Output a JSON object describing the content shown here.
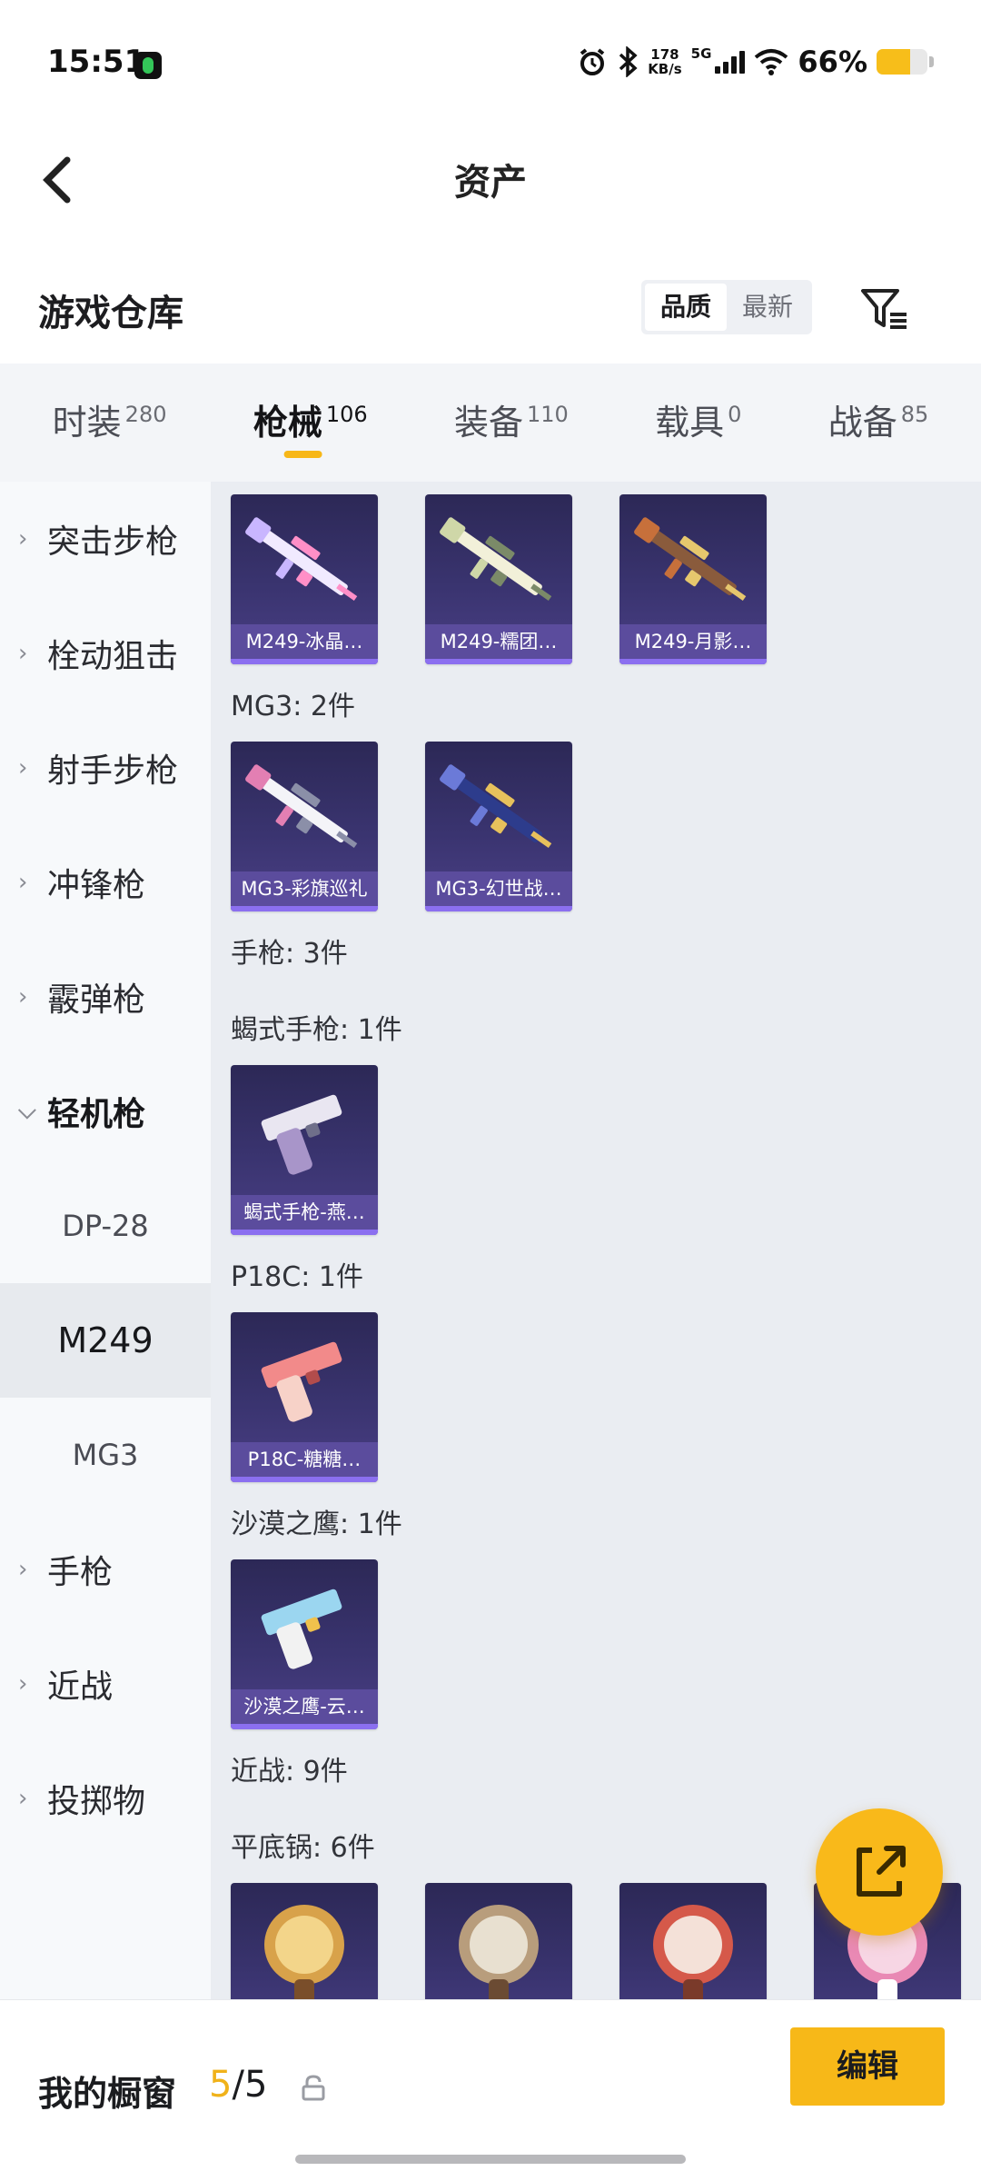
{
  "status_bar": {
    "time": "15:51",
    "speed_value": "178",
    "speed_unit": "KB/s",
    "network": "5G",
    "battery_percent": "66%",
    "battery_level": 0.66,
    "battery_color": "#f7be1a"
  },
  "nav": {
    "title": "资产"
  },
  "warehouse": {
    "title": "游戏仓库",
    "sort_options": [
      "品质",
      "最新"
    ],
    "sort_selected": "品质"
  },
  "tabs": [
    {
      "label": "时装",
      "count": "280"
    },
    {
      "label": "枪械",
      "count": "106",
      "active": true
    },
    {
      "label": "装备",
      "count": "110"
    },
    {
      "label": "载具",
      "count": "0"
    },
    {
      "label": "战备",
      "count": "85"
    }
  ],
  "sidebar": {
    "categories": [
      {
        "label": "突击步枪"
      },
      {
        "label": "栓动狙击"
      },
      {
        "label": "射手步枪"
      },
      {
        "label": "冲锋枪"
      },
      {
        "label": "霰弹枪"
      },
      {
        "label": "轻机枪",
        "expanded": true,
        "children": [
          {
            "label": "DP-28"
          },
          {
            "label": "M249",
            "selected": true
          },
          {
            "label": "MG3"
          }
        ]
      },
      {
        "label": "手枪"
      },
      {
        "label": "近战"
      },
      {
        "label": "投掷物"
      }
    ]
  },
  "content": {
    "m249_items": [
      "M249-冰晶…",
      "M249-糯团…",
      "M249-月影…"
    ],
    "mg3_label": "MG3: 2件",
    "mg3_items": [
      "MG3-彩旗巡礼",
      "MG3-幻世战…"
    ],
    "pistol_label": "手枪: 3件",
    "scorpion_label": "蝎式手枪: 1件",
    "scorpion_items": [
      "蝎式手枪-燕…"
    ],
    "p18c_label": "P18C: 1件",
    "p18c_items": [
      "P18C-糖糖…"
    ],
    "deagle_label": "沙漠之鹰: 1件",
    "deagle_items": [
      "沙漠之鹰-云…"
    ],
    "melee_label": "近战: 9件",
    "pan_label": "平底锅: 6件"
  },
  "bottom_bar": {
    "showcase_label": "我的橱窗",
    "showcase_used": "5",
    "showcase_separator": "/",
    "showcase_total": "5",
    "edit_label": "编辑"
  },
  "colors": {
    "accent": "#f7b818",
    "card_bg": "#3a3470",
    "card_label": "#5b4c9d"
  },
  "icons": [
    "back-arrow-icon",
    "filter-icon",
    "share-icon",
    "lock-icon",
    "chevron-right-icon",
    "chevron-down-icon"
  ]
}
